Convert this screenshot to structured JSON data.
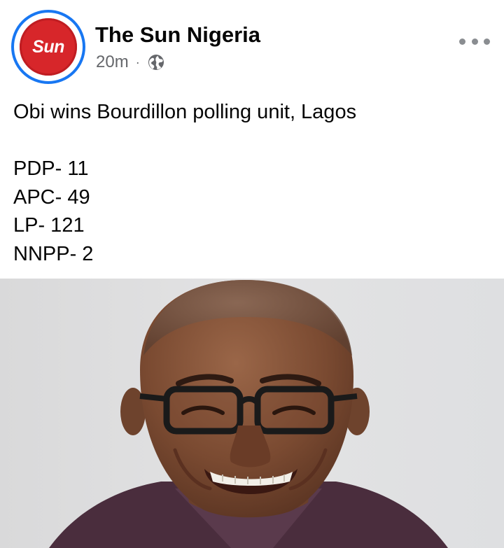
{
  "post": {
    "page_name": "The Sun Nigeria",
    "avatar_logo_text": "Sun",
    "time": "20m",
    "meta_separator": "·",
    "privacy_icon": "globe-icon",
    "more_icon": "more-options-icon",
    "text": {
      "headline": "Obi wins Bourdillon polling unit, Lagos",
      "results": [
        "PDP- 11",
        "APC- 49",
        "LP- 121",
        "NNPP- 2"
      ]
    },
    "photo": {
      "subject": "smiling man with glasses"
    }
  },
  "colors": {
    "brand_red": "#d7262a",
    "story_ring_blue": "#1877f2",
    "meta_gray": "#65676b",
    "text": "#050505"
  }
}
